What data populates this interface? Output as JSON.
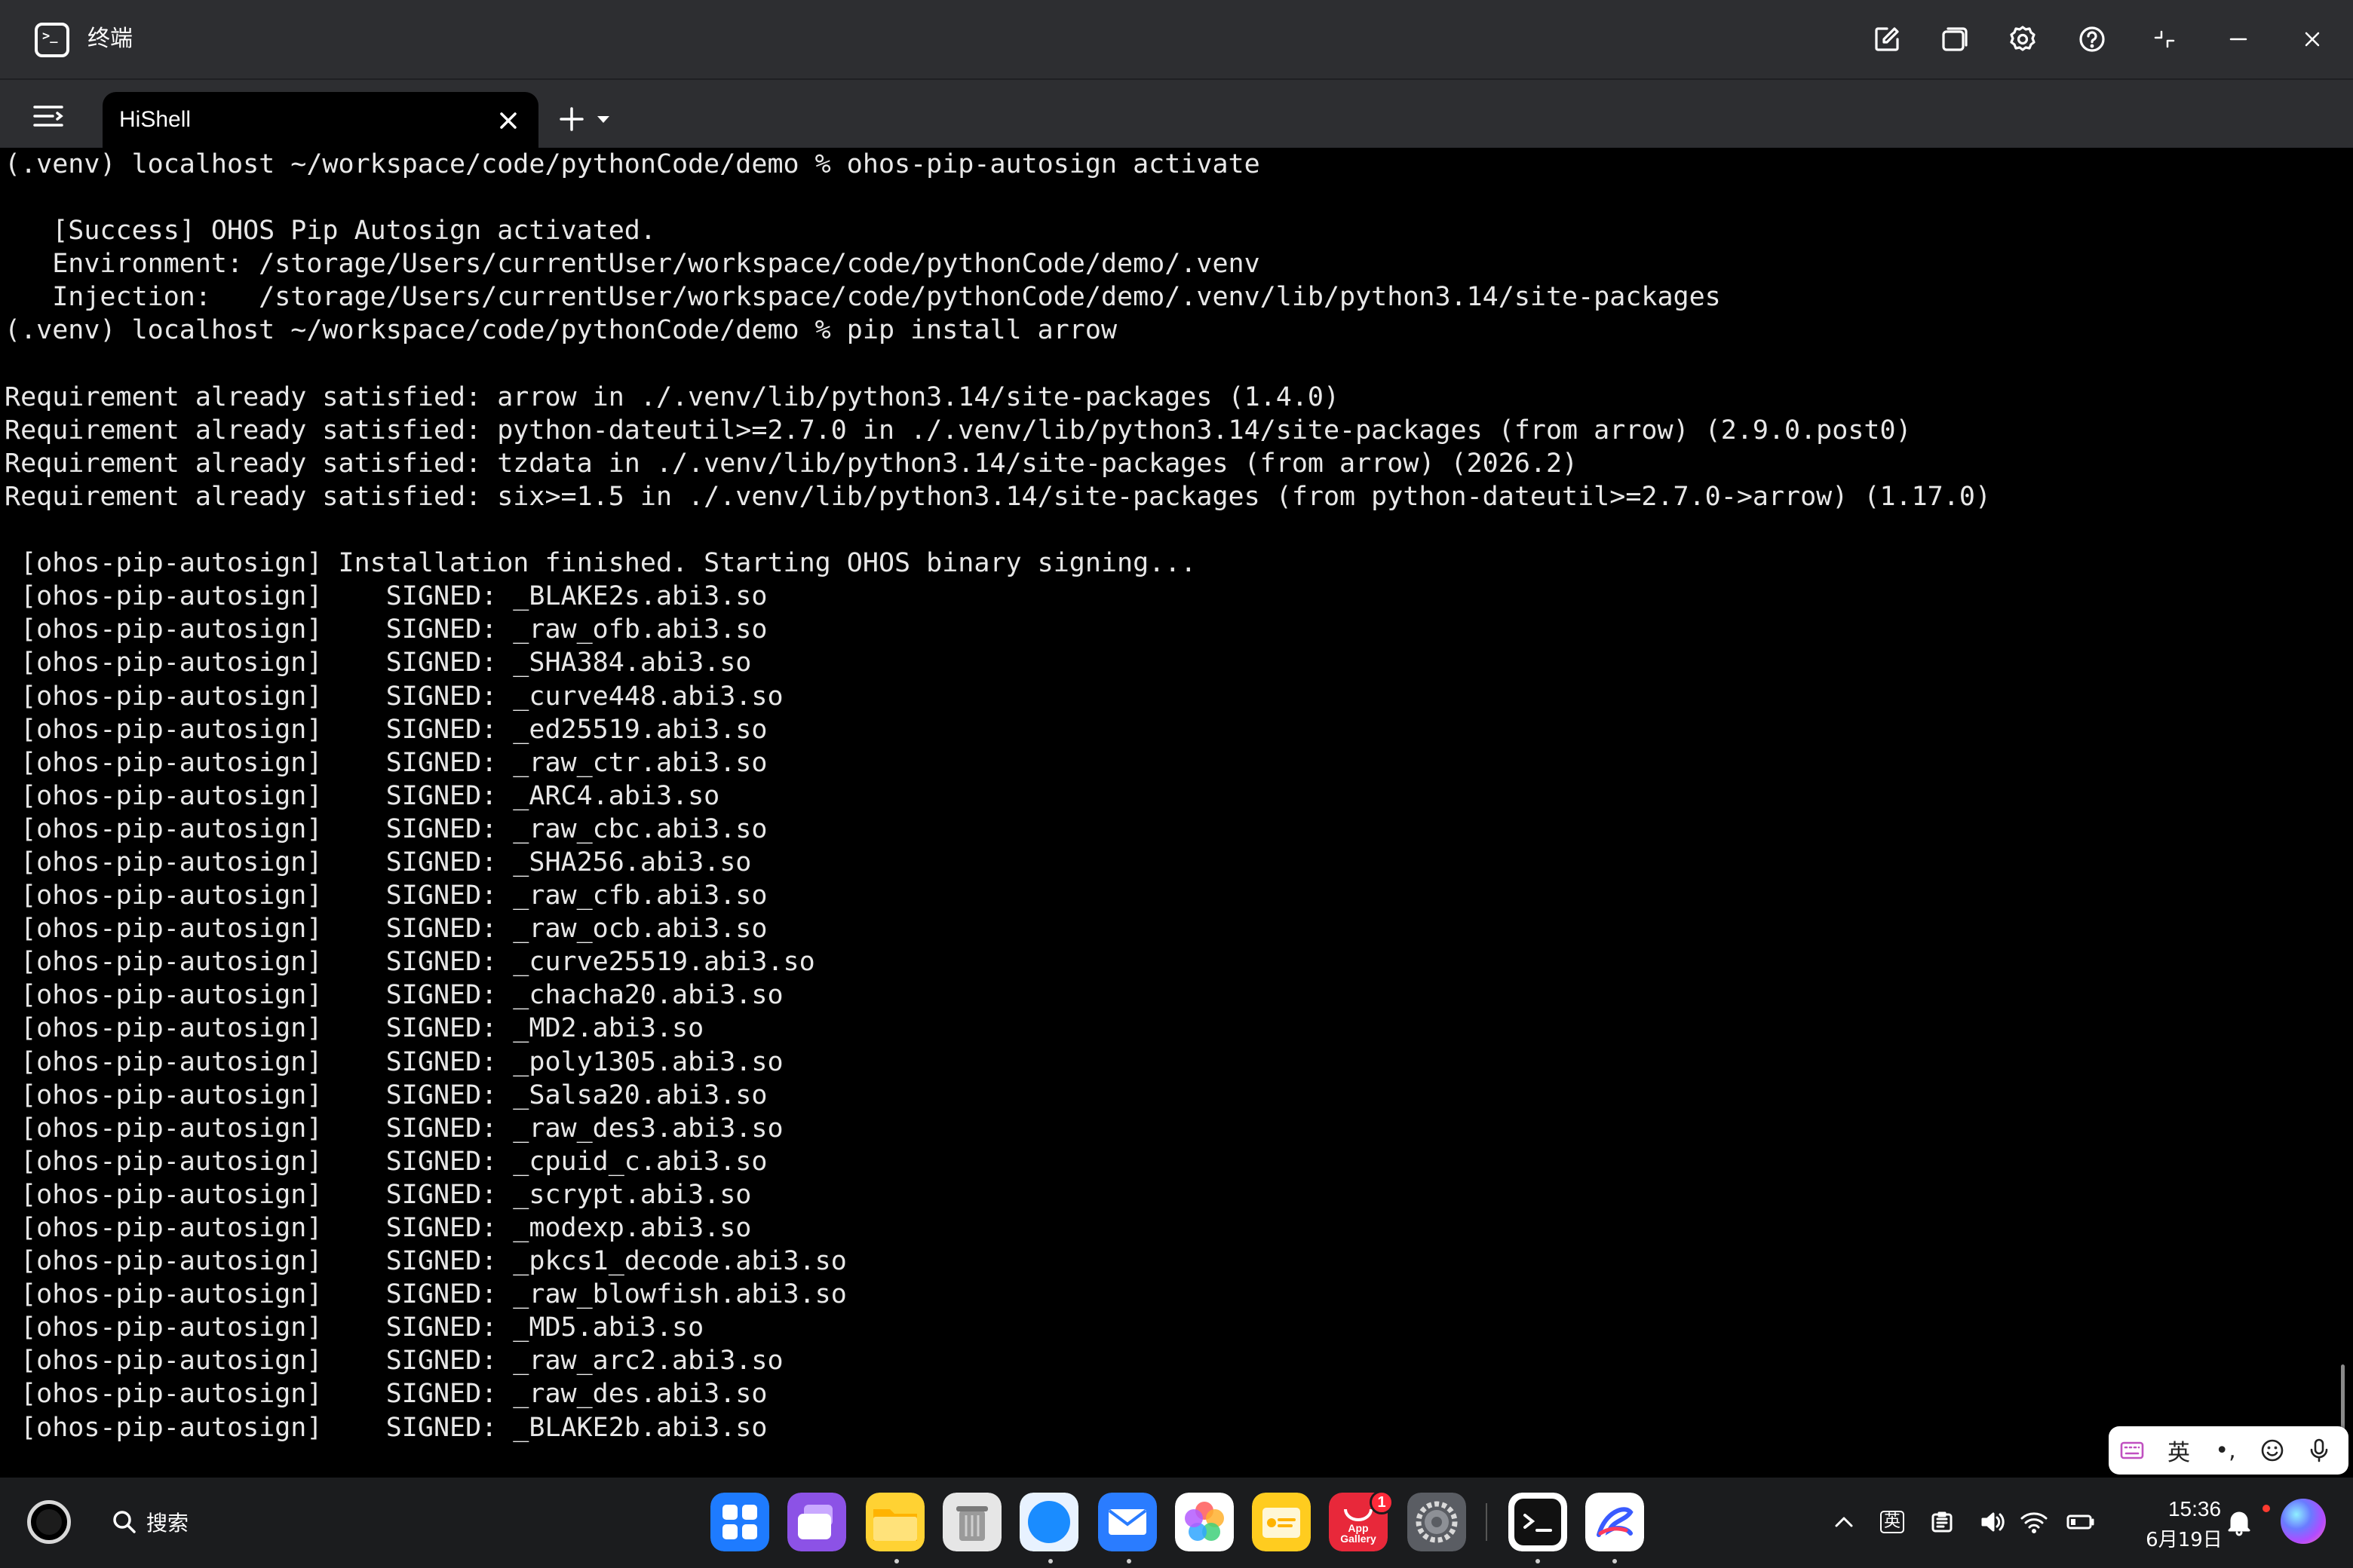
{
  "window": {
    "title": "终端",
    "controls": [
      "edit-icon",
      "window-icon",
      "settings-icon",
      "help-icon",
      "restore-icon",
      "minimize-icon",
      "close-icon"
    ]
  },
  "tabs": {
    "active_label": "HiShell"
  },
  "terminal": {
    "lines": [
      "(.venv) localhost ~/workspace/code/pythonCode/demo % ohos-pip-autosign activate",
      "",
      "   [Success] OHOS Pip Autosign activated.",
      "   Environment: /storage/Users/currentUser/workspace/code/pythonCode/demo/.venv",
      "   Injection:   /storage/Users/currentUser/workspace/code/pythonCode/demo/.venv/lib/python3.14/site-packages",
      "(.venv) localhost ~/workspace/code/pythonCode/demo % pip install arrow",
      "",
      "Requirement already satisfied: arrow in ./.venv/lib/python3.14/site-packages (1.4.0)",
      "Requirement already satisfied: python-dateutil>=2.7.0 in ./.venv/lib/python3.14/site-packages (from arrow) (2.9.0.post0)",
      "Requirement already satisfied: tzdata in ./.venv/lib/python3.14/site-packages (from arrow) (2026.2)",
      "Requirement already satisfied: six>=1.5 in ./.venv/lib/python3.14/site-packages (from python-dateutil>=2.7.0->arrow) (1.17.0)",
      "",
      " [ohos-pip-autosign] Installation finished. Starting OHOS binary signing...",
      " [ohos-pip-autosign]    SIGNED: _BLAKE2s.abi3.so",
      " [ohos-pip-autosign]    SIGNED: _raw_ofb.abi3.so",
      " [ohos-pip-autosign]    SIGNED: _SHA384.abi3.so",
      " [ohos-pip-autosign]    SIGNED: _curve448.abi3.so",
      " [ohos-pip-autosign]    SIGNED: _ed25519.abi3.so",
      " [ohos-pip-autosign]    SIGNED: _raw_ctr.abi3.so",
      " [ohos-pip-autosign]    SIGNED: _ARC4.abi3.so",
      " [ohos-pip-autosign]    SIGNED: _raw_cbc.abi3.so",
      " [ohos-pip-autosign]    SIGNED: _SHA256.abi3.so",
      " [ohos-pip-autosign]    SIGNED: _raw_cfb.abi3.so",
      " [ohos-pip-autosign]    SIGNED: _raw_ocb.abi3.so",
      " [ohos-pip-autosign]    SIGNED: _curve25519.abi3.so",
      " [ohos-pip-autosign]    SIGNED: _chacha20.abi3.so",
      " [ohos-pip-autosign]    SIGNED: _MD2.abi3.so",
      " [ohos-pip-autosign]    SIGNED: _poly1305.abi3.so",
      " [ohos-pip-autosign]    SIGNED: _Salsa20.abi3.so",
      " [ohos-pip-autosign]    SIGNED: _raw_des3.abi3.so",
      " [ohos-pip-autosign]    SIGNED: _cpuid_c.abi3.so",
      " [ohos-pip-autosign]    SIGNED: _scrypt.abi3.so",
      " [ohos-pip-autosign]    SIGNED: _modexp.abi3.so",
      " [ohos-pip-autosign]    SIGNED: _pkcs1_decode.abi3.so",
      " [ohos-pip-autosign]    SIGNED: _raw_blowfish.abi3.so",
      " [ohos-pip-autosign]    SIGNED: _MD5.abi3.so",
      " [ohos-pip-autosign]    SIGNED: _raw_arc2.abi3.so",
      " [ohos-pip-autosign]    SIGNED: _raw_des.abi3.so",
      " [ohos-pip-autosign]    SIGNED: _BLAKE2b.abi3.so"
    ]
  },
  "ime": {
    "language": "英",
    "punct": "•,"
  },
  "dock": {
    "search_label": "搜索",
    "apps": [
      "app-center-icon",
      "multitask-icon",
      "files-icon",
      "trash-icon",
      "browser-icon",
      "mail-icon",
      "photos-icon",
      "notes-icon",
      "app-gallery-icon",
      "settings-icon",
      "terminal-icon",
      "pen-icon"
    ],
    "app_gallery_label_1": "App",
    "app_gallery_label_2": "Gallery",
    "app_gallery_badge": "1",
    "ime_indicator": "英",
    "time": "15:36",
    "date": "6月19日"
  }
}
